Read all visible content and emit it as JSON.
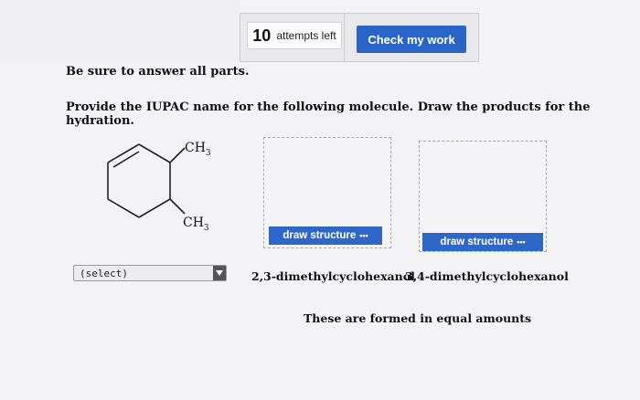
{
  "toolbar": {
    "attempts_count": "10",
    "attempts_label": "attempts left",
    "check_label": "Check my work"
  },
  "question": {
    "instruction": "Be sure to answer all parts.",
    "prompt": "Provide the IUPAC name for the following molecule. Draw the products for the hydration."
  },
  "molecule": {
    "label_top": "CH3",
    "label_bottom": "CH3"
  },
  "draw_boxes": [
    {
      "button_label": "draw structure",
      "button_icon": "ellipsis-icon"
    },
    {
      "button_label": "draw structure",
      "button_icon": "ellipsis-icon"
    }
  ],
  "select": {
    "value": "(select)"
  },
  "options": [
    "2,3-dimethylcyclohexanol",
    "3,4-dimethylcyclohexanol"
  ],
  "note": "These are formed in equal amounts",
  "colors": {
    "accent": "#2a64c7",
    "background": "#f3f3f5"
  }
}
